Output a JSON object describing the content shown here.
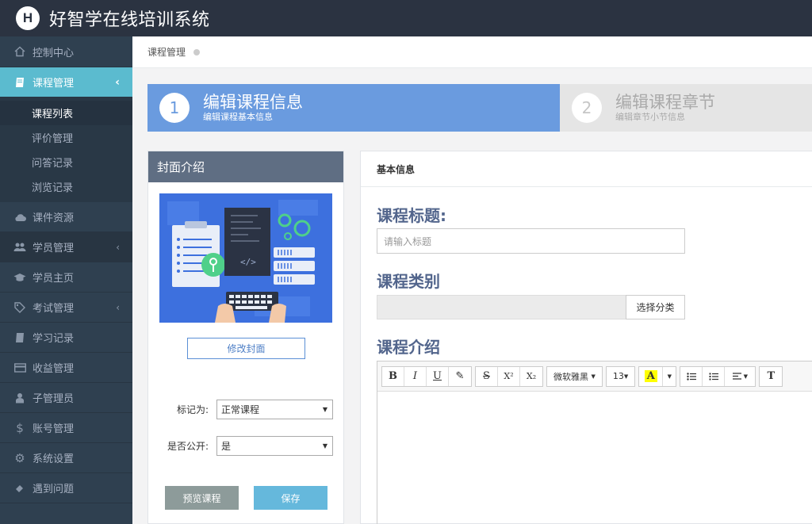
{
  "header": {
    "logo_letter": "H",
    "title": "好智学在线培训系统"
  },
  "sidebar": {
    "items": [
      {
        "label": "控制中心",
        "icon": "home-icon"
      },
      {
        "label": "课程管理",
        "icon": "book-icon",
        "active": true
      },
      {
        "label": "课件资源",
        "icon": "cloud-icon"
      },
      {
        "label": "学员管理",
        "icon": "users-icon"
      },
      {
        "label": "学员主页",
        "icon": "graduation-cap-icon"
      },
      {
        "label": "考试管理",
        "icon": "tag-icon"
      },
      {
        "label": "学习记录",
        "icon": "book-icon"
      },
      {
        "label": "收益管理",
        "icon": "credit-card-icon"
      },
      {
        "label": "子管理员",
        "icon": "user-icon"
      },
      {
        "label": "账号管理",
        "icon": "dollar-icon"
      },
      {
        "label": "系统设置",
        "icon": "gear-icon"
      },
      {
        "label": "遇到问题",
        "icon": "paperclip-icon"
      }
    ],
    "submenu": [
      "课程列表",
      "评价管理",
      "问答记录",
      "浏览记录"
    ]
  },
  "breadcrumb": {
    "current": "课程管理"
  },
  "steps": [
    {
      "num": "1",
      "title": "编辑课程信息",
      "sub": "编辑课程基本信息"
    },
    {
      "num": "2",
      "title": "编辑课程章节",
      "sub": "编辑章节小节信息"
    }
  ],
  "cover": {
    "heading": "封面介绍",
    "change_button": "修改封面",
    "mark_label": "标记为:",
    "mark_value": "正常课程",
    "public_label": "是否公开:",
    "public_value": "是",
    "preview_button": "预览课程",
    "save_button": "保存"
  },
  "info": {
    "heading": "基本信息",
    "title_label": "课程标题:",
    "title_placeholder": "请输入标题",
    "category_label": "课程类别",
    "category_button": "选择分类",
    "intro_label": "课程介绍",
    "toolbar": {
      "bold": "B",
      "italic": "I",
      "underline": "U",
      "eraser": "✎",
      "strike": "S",
      "superscript": "X²",
      "subscript": "X₂",
      "font": "微软雅黑",
      "size": "13",
      "color_letter": "A",
      "more": "T"
    }
  },
  "colors": {
    "accent": "#5bbbcf",
    "step_active": "#6a9bdf",
    "sidebar": "#2f4050"
  }
}
